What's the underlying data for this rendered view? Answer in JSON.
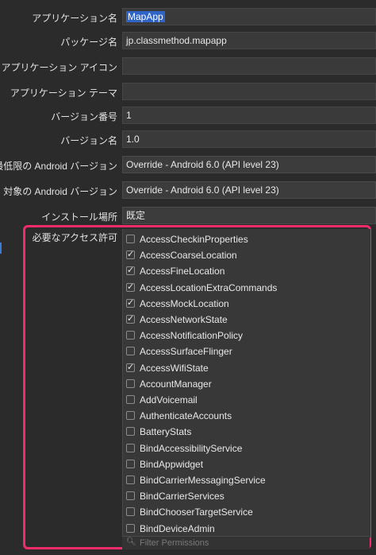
{
  "settings": [
    {
      "label": "アプリケーション名",
      "value": "MapApp",
      "selected": true
    },
    {
      "label": "パッケージ名",
      "value": "jp.classmethod.mapapp"
    },
    {
      "label": "アプリケーション アイコン",
      "value": ""
    },
    {
      "label": "アプリケーション テーマ",
      "value": ""
    },
    {
      "label": "バージョン番号",
      "value": "1"
    },
    {
      "label": "バージョン名",
      "value": "1.0"
    },
    {
      "label": "最低限の Android バージョン",
      "value": "Override - Android 6.0 (API level 23)"
    },
    {
      "label": "対象の Android バージョン",
      "value": "Override - Android 6.0 (API level 23)"
    },
    {
      "label": "インストール場所",
      "value": "既定"
    }
  ],
  "permissions_label": "必要なアクセス許可",
  "permissions": [
    {
      "name": "AccessCheckinProperties",
      "checked": false
    },
    {
      "name": "AccessCoarseLocation",
      "checked": true
    },
    {
      "name": "AccessFineLocation",
      "checked": true
    },
    {
      "name": "AccessLocationExtraCommands",
      "checked": true
    },
    {
      "name": "AccessMockLocation",
      "checked": true
    },
    {
      "name": "AccessNetworkState",
      "checked": true
    },
    {
      "name": "AccessNotificationPolicy",
      "checked": false
    },
    {
      "name": "AccessSurfaceFlinger",
      "checked": false
    },
    {
      "name": "AccessWifiState",
      "checked": true
    },
    {
      "name": "AccountManager",
      "checked": false
    },
    {
      "name": "AddVoicemail",
      "checked": false
    },
    {
      "name": "AuthenticateAccounts",
      "checked": false
    },
    {
      "name": "BatteryStats",
      "checked": false
    },
    {
      "name": "BindAccessibilityService",
      "checked": false
    },
    {
      "name": "BindAppwidget",
      "checked": false
    },
    {
      "name": "BindCarrierMessagingService",
      "checked": false
    },
    {
      "name": "BindCarrierServices",
      "checked": false
    },
    {
      "name": "BindChooserTargetService",
      "checked": false
    },
    {
      "name": "BindDeviceAdmin",
      "checked": false
    }
  ],
  "filter_placeholder": "Filter Permissions",
  "colors": {
    "highlight": "#f22b6b",
    "selection": "#2f63c6"
  }
}
